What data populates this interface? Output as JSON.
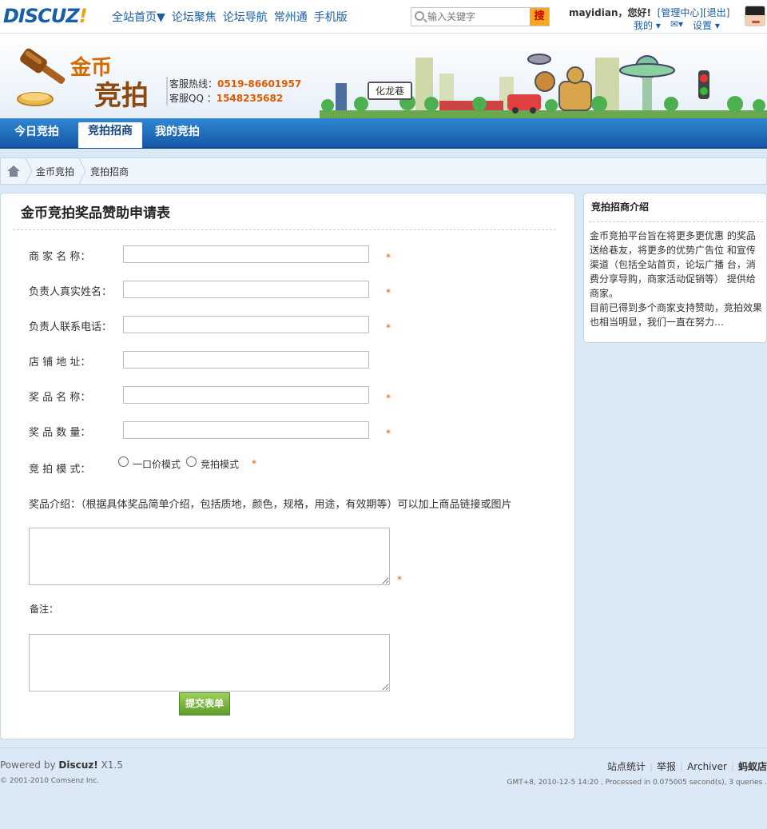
{
  "header": {
    "logo": "DISCUZ",
    "logo_mark": "!",
    "nav": [
      "全站首页▼",
      "论坛聚焦",
      "论坛导航",
      "常州通",
      "手机版"
    ],
    "search_placeholder": "输入关键字",
    "search_button": "搜",
    "user_name": "mayidian",
    "greeting": "，您好!",
    "admin_link": "[管理中心]",
    "logout_link": "[退出]",
    "my_menu": "我的",
    "settings_menu": "设置"
  },
  "banner": {
    "title_top": "金币",
    "title_bottom": "竞拍",
    "hotline_label": "客服热线：",
    "hotline_value": "0519-86601957",
    "qq_label": "客服QQ  ：",
    "qq_value": "1548235682",
    "sign": "化龙巷"
  },
  "tabs": [
    {
      "label": "今日竞拍",
      "active": false
    },
    {
      "label": "竞拍招商",
      "active": true
    },
    {
      "label": "我的竞拍",
      "active": false
    }
  ],
  "breadcrumb": [
    "金币竞拍",
    "竞拍招商"
  ],
  "form": {
    "title": "金币竞拍奖品赞助申请表",
    "fields": [
      {
        "label": "商 家 名 称：",
        "value": "",
        "required": true
      },
      {
        "label": "负责人真实姓名：",
        "value": "",
        "required": true
      },
      {
        "label": "负责人联系电话：",
        "value": "",
        "required": true
      },
      {
        "label": "店 铺 地 址：",
        "value": "",
        "required": false
      },
      {
        "label": "奖 品 名 称：",
        "value": "",
        "required": true
      },
      {
        "label": "奖 品 数 量：",
        "value": "",
        "required": true
      }
    ],
    "mode_label": "竞 拍 模 式：",
    "mode_options": [
      "一口价模式",
      "竞拍模式"
    ],
    "required_mark": "*",
    "intro_label": "奖品介绍：（根据具体奖品简单介绍，包括质地，颜色，规格，用途，有效期等）可以加上商品链接或图片",
    "remark_label": "备注：",
    "submit_label": "提交表单"
  },
  "side": {
    "title": "竞拍招商介绍",
    "text": "金币竞拍平台旨在将更多更优惠 的奖品送给巷友，将更多的优势广告位 和宣传渠道（包括全站首页，论坛广播 台，消费分享导购，商家活动促销等） 提供给商家。\n目前已得到多个商家支持赞助，竞拍效果也相当明显，我们一直在努力…"
  },
  "footer": {
    "powered_prefix": "Powered by ",
    "powered_brand": "Discuz!",
    "powered_version": " X1.5",
    "copyright": "© 2001-2010 Comsenz Inc.",
    "links": [
      "站点统计",
      "举报",
      "Archiver"
    ],
    "site_name": "蚂蚁店",
    "time_info": "GMT+8, 2010-12-5 14:20 , Processed in 0.075005 second(s), 3 queries ."
  }
}
